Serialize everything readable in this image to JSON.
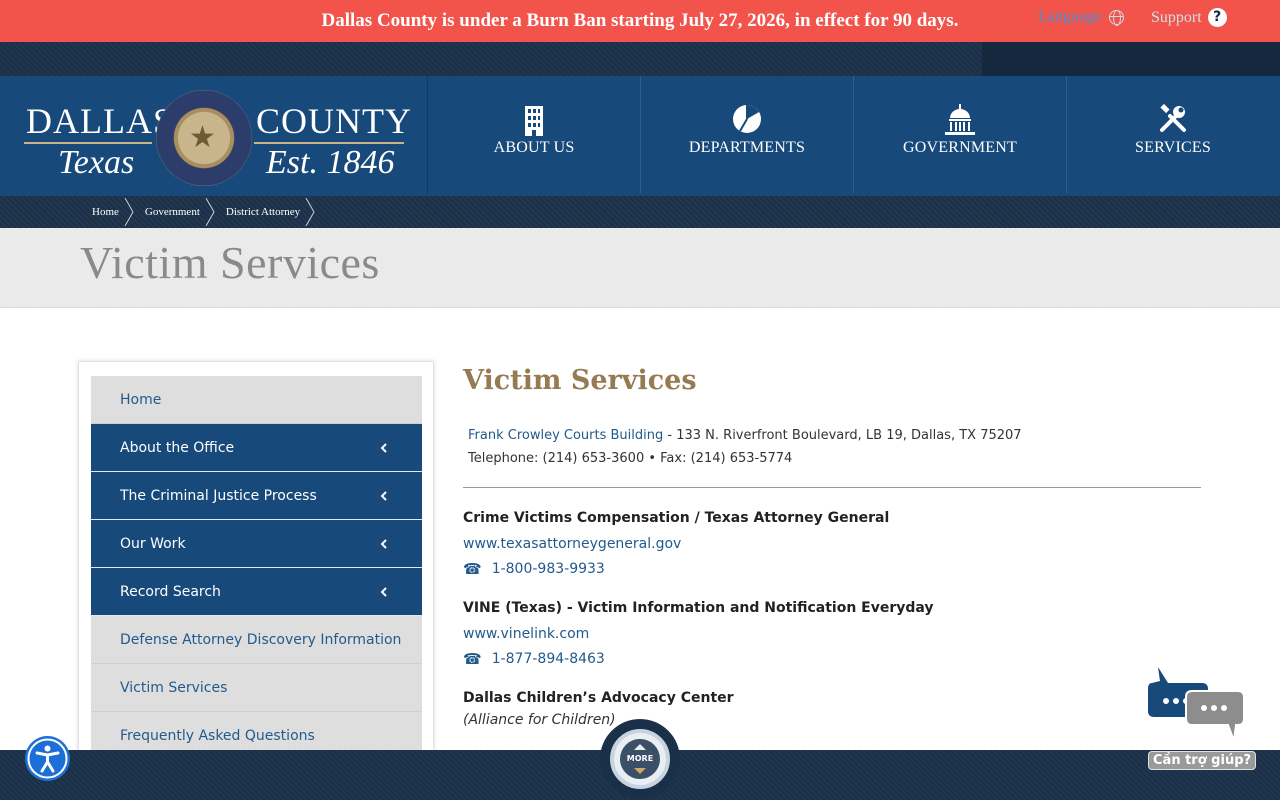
{
  "alert": {
    "text": "Dallas County is under a Burn Ban starting July 27, 2026, in effect for 90 days."
  },
  "utility": {
    "language_label": "Language",
    "support_label": "Support",
    "support_icon": "?"
  },
  "logo": {
    "word_left": "DALLAS",
    "word_right": "COUNTY",
    "sub_left": "Texas",
    "sub_right": "Est. 1846"
  },
  "nav": {
    "items": [
      {
        "label": "ABOUT US",
        "icon": "building-icon"
      },
      {
        "label": "DEPARTMENTS",
        "icon": "pie-chart-icon"
      },
      {
        "label": "GOVERNMENT",
        "icon": "capitol-icon"
      },
      {
        "label": "SERVICES",
        "icon": "tools-icon"
      }
    ]
  },
  "breadcrumb": {
    "items": [
      "Home",
      "Government",
      "District Attorney"
    ]
  },
  "page": {
    "title": "Victim Services"
  },
  "sidebar": {
    "items": [
      {
        "label": "Home",
        "style": "light",
        "expandable": false
      },
      {
        "label": "About the Office",
        "style": "dark",
        "expandable": true
      },
      {
        "label": "The Criminal Justice Process",
        "style": "dark",
        "expandable": true
      },
      {
        "label": "Our Work",
        "style": "dark",
        "expandable": true
      },
      {
        "label": "Record Search",
        "style": "dark",
        "expandable": true
      },
      {
        "label": "Defense Attorney Discovery Information",
        "style": "light",
        "expandable": false
      },
      {
        "label": "Victim Services",
        "style": "light",
        "expandable": false
      },
      {
        "label": "Frequently Asked Questions",
        "style": "light",
        "expandable": false
      }
    ]
  },
  "main": {
    "heading": "Victim Services",
    "address": {
      "building_link": "Frank Crowley Courts Building",
      "address_text": " - 133 N. Riverfront Boulevard, LB 19, Dallas, TX 75207",
      "contact": "Telephone: (214) 653-3600 • Fax: (214) 653-5774"
    },
    "entries": [
      {
        "title": "Crime Victims Compensation / Texas Attorney General",
        "url": "www.texasattorneygeneral.gov",
        "phone": "1-800-983-9933"
      },
      {
        "title": "VINE (Texas) - Victim Information and Notification Everyday",
        "url": "www.vinelink.com",
        "phone": "1-877-894-8463"
      },
      {
        "title": "Dallas Children’s Advocacy Center",
        "subtitle": "(Alliance for Children)"
      }
    ],
    "phone_icon": "☎"
  },
  "more_button": {
    "label": "MORE"
  },
  "chat": {
    "label": "Cần trợ giúp?"
  },
  "colors": {
    "alert_bg": "#f2544c",
    "header_blue": "#17497b",
    "dark_bar": "#1a3048",
    "heading_gold": "#957a52",
    "link_blue": "#235a8c"
  }
}
